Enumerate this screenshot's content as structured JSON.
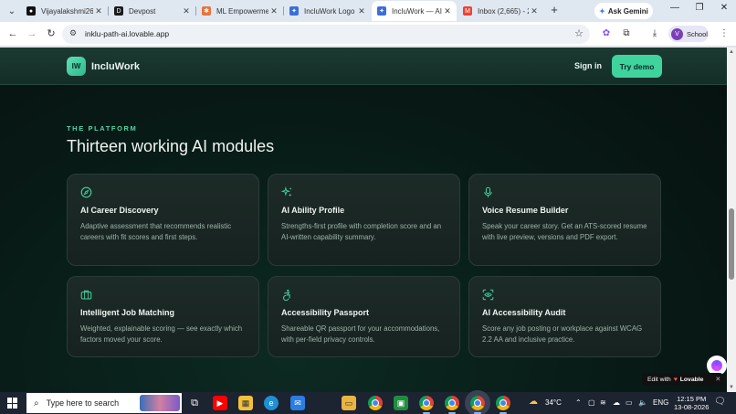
{
  "browser": {
    "tabs": [
      {
        "title": "Vijayalakshmi26(",
        "favicon": "github-icon",
        "active": false
      },
      {
        "title": "Devpost",
        "favicon": "devpost-icon",
        "active": false
      },
      {
        "title": "ML Empowermen",
        "favicon": "ml-icon",
        "active": false
      },
      {
        "title": "IncluWork Logo I",
        "favicon": "lovable-icon",
        "active": false
      },
      {
        "title": "IncluWork — AI I",
        "favicon": "lovable-icon",
        "active": true
      },
      {
        "title": "Inbox (2,665) - 2",
        "favicon": "gmail-icon",
        "active": false
      }
    ],
    "gemini_label": "Ask Gemini",
    "url": "inklu-path-ai.lovable.app",
    "profile_initial": "V",
    "profile_label": "School"
  },
  "site": {
    "logo_mark": "IW",
    "logo_text": "IncluWork",
    "nav": {
      "signin": "Sign in",
      "cta": "Try demo"
    },
    "eyebrow": "THE PLATFORM",
    "title": "Thirteen working AI modules",
    "accent": "#3fd39e",
    "modules": [
      {
        "icon": "compass-icon",
        "title": "AI Career Discovery",
        "description": "Adaptive assessment that recommends realistic careers with fit scores and first steps."
      },
      {
        "icon": "sparkles-icon",
        "title": "AI Ability Profile",
        "description": "Strengths-first profile with completion score and an AI-written capability summary."
      },
      {
        "icon": "microphone-icon",
        "title": "Voice Resume Builder",
        "description": "Speak your career story. Get an ATS-scored resume with live preview, versions and PDF export."
      },
      {
        "icon": "briefcase-icon",
        "title": "Intelligent Job Matching",
        "description": "Weighted, explainable scoring — see exactly which factors moved your score."
      },
      {
        "icon": "accessibility-icon",
        "title": "Accessibility Passport",
        "description": "Shareable QR passport for your accommodations, with per-field privacy controls."
      },
      {
        "icon": "scan-eye-icon",
        "title": "AI Accessibility Audit",
        "description": "Score any job posting or workplace against WCAG 2.2 AA and inclusive practice."
      }
    ],
    "badge": {
      "prefix": "Edit with",
      "brand": "Lovable"
    }
  },
  "taskbar": {
    "search_placeholder": "Type here to search",
    "temperature": "34°C",
    "language": "ENG",
    "time": "12:15 PM",
    "date": "13-08-2026"
  }
}
